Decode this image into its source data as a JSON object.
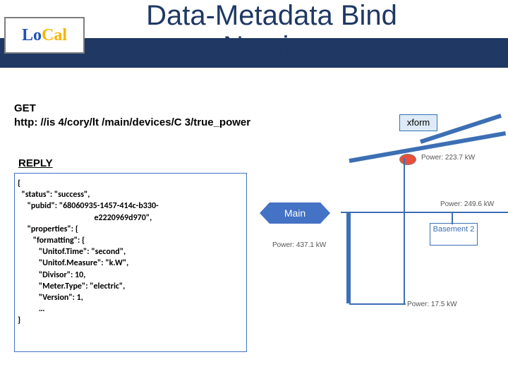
{
  "logo": {
    "lo": "Lo",
    "cal": "Cal"
  },
  "title": "Data-Metadata Bind Naming",
  "request": {
    "method": "GET",
    "url": "http: //is 4/cory/lt /main/devices/C 3/true_power"
  },
  "reply_label": "REPLY",
  "reply_body": "{\n  \"status\": \"success\",\n     \"pubid\": \"68060935-1457-414c-b330-\n                                        e2220969d970\",\n     \"properties\": {\n        \"formatting\": {\n           \"Unitof.Time\": \"second\",\n           \"Unitof.Measure\": \"k.W\",\n           \"Divisor\": 10,\n           \"Meter.Type\": \"electric\",\n           \"Version\": 1,\n           …\n}",
  "xform": "xform",
  "main_arrow": "Main",
  "basement": "Basement\n2",
  "power": {
    "top": "Power: 223.7 kW",
    "mid": "Power: 437.1 kW",
    "right": "Power: 249.6 kW",
    "bottom": "Power: 17.5 kW"
  }
}
